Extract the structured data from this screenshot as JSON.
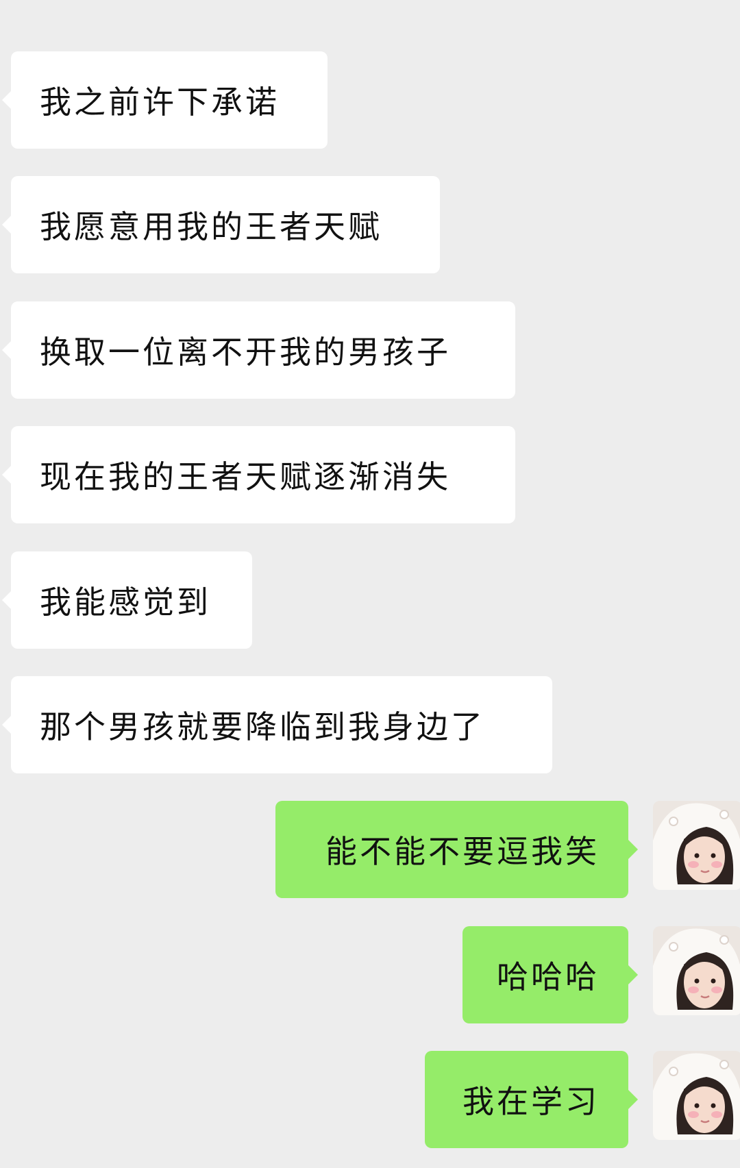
{
  "messages": [
    {
      "side": "in",
      "text": "我之前许下承诺"
    },
    {
      "side": "in",
      "text": "我愿意用我的王者天赋"
    },
    {
      "side": "in",
      "text": "换取一位离不开我的男孩子"
    },
    {
      "side": "in",
      "text": "现在我的王者天赋逐渐消失"
    },
    {
      "side": "in",
      "text": "我能感觉到"
    },
    {
      "side": "in",
      "text": "那个男孩就要降临到我身边了"
    },
    {
      "side": "out",
      "text": "能不能不要逗我笑"
    },
    {
      "side": "out",
      "text": "哈哈哈"
    },
    {
      "side": "out",
      "text": "我在学习"
    }
  ],
  "colors": {
    "background": "#ededed",
    "incoming_bubble": "#ffffff",
    "outgoing_bubble": "#95ec69",
    "text": "#111111"
  },
  "avatar": {
    "icon": "user-avatar-icon"
  }
}
